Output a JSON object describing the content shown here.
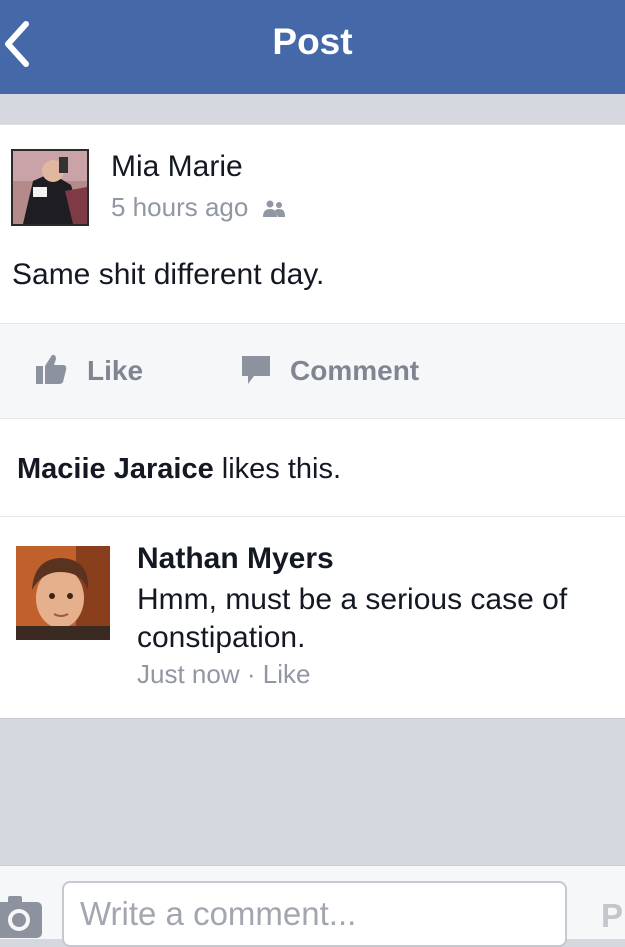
{
  "header": {
    "title": "Post",
    "back_icon": "chevron-left-icon",
    "background_color": "#4468a8"
  },
  "post": {
    "author": "Mia Marie",
    "timestamp": "5 hours ago",
    "audience_icon": "friends-icon",
    "text": "Same shit different day."
  },
  "actions": {
    "like_label": "Like",
    "like_icon": "thumbs-up-icon",
    "comment_label": "Comment",
    "comment_icon": "speech-bubble-icon"
  },
  "likes": {
    "name": "Maciie Jaraice",
    "suffix": "likes this."
  },
  "comments": [
    {
      "author": "Nathan Myers",
      "text": "Hmm, must be a serious case of constipation.",
      "timestamp": "Just now",
      "separator": "·",
      "like_label": "Like"
    }
  ],
  "composer": {
    "camera_icon": "camera-icon",
    "placeholder": "Write a comment...",
    "post_label": "P"
  }
}
